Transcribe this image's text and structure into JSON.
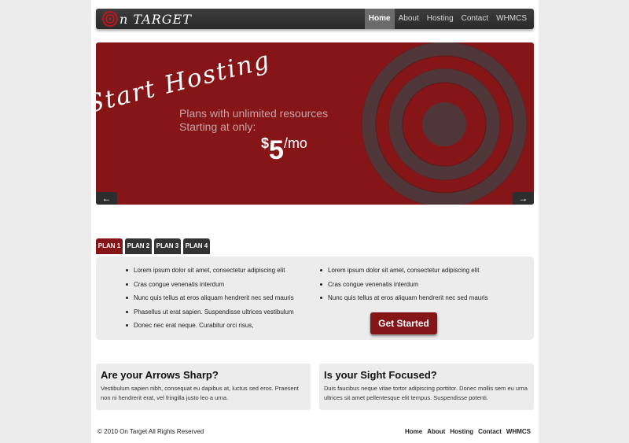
{
  "header": {
    "logo_text": "n TARGET",
    "nav": [
      {
        "label": "Home",
        "active": true
      },
      {
        "label": "About",
        "active": false
      },
      {
        "label": "Hosting",
        "active": false
      },
      {
        "label": "Contact",
        "active": false
      },
      {
        "label": "WHMCS",
        "active": false
      }
    ]
  },
  "hero": {
    "script_title": "Start Hosting",
    "line1": "Plans  with unlimited resources",
    "line2": "Starting at only:",
    "price_currency": "$",
    "price_amount": "5",
    "price_unit": "/mo",
    "prev_icon": "arrow-left-icon",
    "next_icon": "arrow-right-icon"
  },
  "plans": {
    "tabs": [
      "PLAN 1",
      "PLAN 2",
      "PLAN 3",
      "PLAN 4"
    ],
    "active_tab": 0,
    "left_items": [
      "Lorem ipsum dolor sit amet, consectetur adipiscing elit",
      "Cras congue venenatis interdum",
      "Nunc quis tellus at eros aliquam hendrerit nec sed mauris",
      "Phasellus ut erat sapien. Suspendisse ultrices vestibulum",
      "Donec nec erat neque. Curabitur orci risus,"
    ],
    "right_items": [
      "Lorem ipsum dolor sit amet, consectetur adipiscing elit",
      "Cras congue venenatis interdum",
      "Nunc quis tellus at eros aliquam hendrerit nec sed mauris"
    ],
    "cta": "Get Started"
  },
  "features": [
    {
      "title": "Are your Arrows Sharp?",
      "text": "Vestibulum sapien nibh, consequat eu dapibus at, luctus sed eros. Praesent non ni hendrerit erat, vel fringilla justo leo a urna."
    },
    {
      "title": "Is your Sight Focused?",
      "text": "Duis faucibus neque vitae tortor adipiscing porttitor. Donec mollis sem eu urna ultrices sit amet pellentesque elit tempus. Suspendisse potenti."
    }
  ],
  "footer": {
    "copyright": "© 2010 On Target All Rights Reserved",
    "nav": [
      "Home",
      "About",
      "Hosting",
      "Contact",
      "WHMCS"
    ]
  },
  "colors": {
    "brand_red": "#861518",
    "header_dark": "#333333",
    "page_bg": "#ececec"
  }
}
